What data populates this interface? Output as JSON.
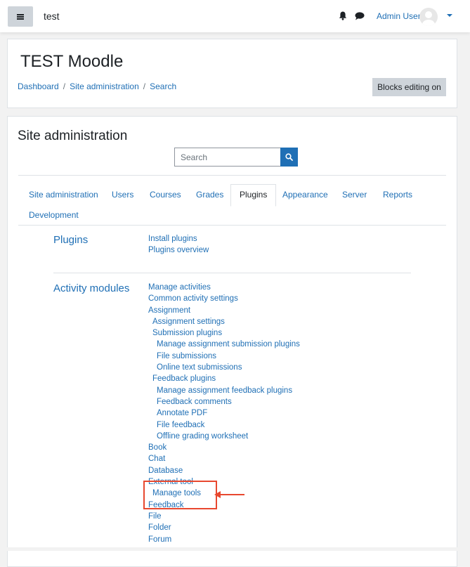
{
  "navbar": {
    "site_name": "test",
    "user_name": "Admin User",
    "icons": [
      "menu-icon",
      "bell-icon",
      "chat-icon",
      "user-avatar-icon",
      "caret-down-icon"
    ]
  },
  "header": {
    "title": "TEST Moodle",
    "breadcrumb": [
      "Dashboard",
      "Site administration",
      "Search"
    ],
    "breadcrumb_separator": "/",
    "blocks_editing_label": "Blocks editing on"
  },
  "main": {
    "title": "Site administration",
    "search": {
      "placeholder": "Search",
      "value": ""
    },
    "tabs": [
      {
        "label": "Site administration",
        "active": false
      },
      {
        "label": "Users",
        "active": false
      },
      {
        "label": "Courses",
        "active": false
      },
      {
        "label": "Grades",
        "active": false
      },
      {
        "label": "Plugins",
        "active": true
      },
      {
        "label": "Appearance",
        "active": false
      },
      {
        "label": "Server",
        "active": false
      },
      {
        "label": "Reports",
        "active": false
      },
      {
        "label": "Development",
        "active": false
      }
    ],
    "sections": [
      {
        "title": "Plugins",
        "links": [
          {
            "label": "Install plugins",
            "indent": 0
          },
          {
            "label": "Plugins overview",
            "indent": 0
          }
        ]
      },
      {
        "title": "Activity modules",
        "links": [
          {
            "label": "Manage activities",
            "indent": 0
          },
          {
            "label": "Common activity settings",
            "indent": 0
          },
          {
            "label": "Assignment",
            "indent": 0
          },
          {
            "label": "Assignment settings",
            "indent": 1
          },
          {
            "label": "Submission plugins",
            "indent": 1
          },
          {
            "label": "Manage assignment submission plugins",
            "indent": 2
          },
          {
            "label": "File submissions",
            "indent": 2
          },
          {
            "label": "Online text submissions",
            "indent": 2
          },
          {
            "label": "Feedback plugins",
            "indent": 1
          },
          {
            "label": "Manage assignment feedback plugins",
            "indent": 2
          },
          {
            "label": "Feedback comments",
            "indent": 2
          },
          {
            "label": "Annotate PDF",
            "indent": 2
          },
          {
            "label": "File feedback",
            "indent": 2
          },
          {
            "label": "Offline grading worksheet",
            "indent": 2
          },
          {
            "label": "Book",
            "indent": 0
          },
          {
            "label": "Chat",
            "indent": 0
          },
          {
            "label": "Database",
            "indent": 0
          },
          {
            "label": "External tool",
            "indent": 0
          },
          {
            "label": "Manage tools",
            "indent": 1
          },
          {
            "label": "Feedback",
            "indent": 0
          },
          {
            "label": "File",
            "indent": 0
          },
          {
            "label": "Folder",
            "indent": 0
          },
          {
            "label": "Forum",
            "indent": 0
          }
        ]
      }
    ]
  },
  "annotation": {
    "highlight_color": "#e8482f"
  },
  "colors": {
    "link": "#1f6fb5",
    "button_gray": "#ced4da",
    "background": "#f2f2f2"
  }
}
